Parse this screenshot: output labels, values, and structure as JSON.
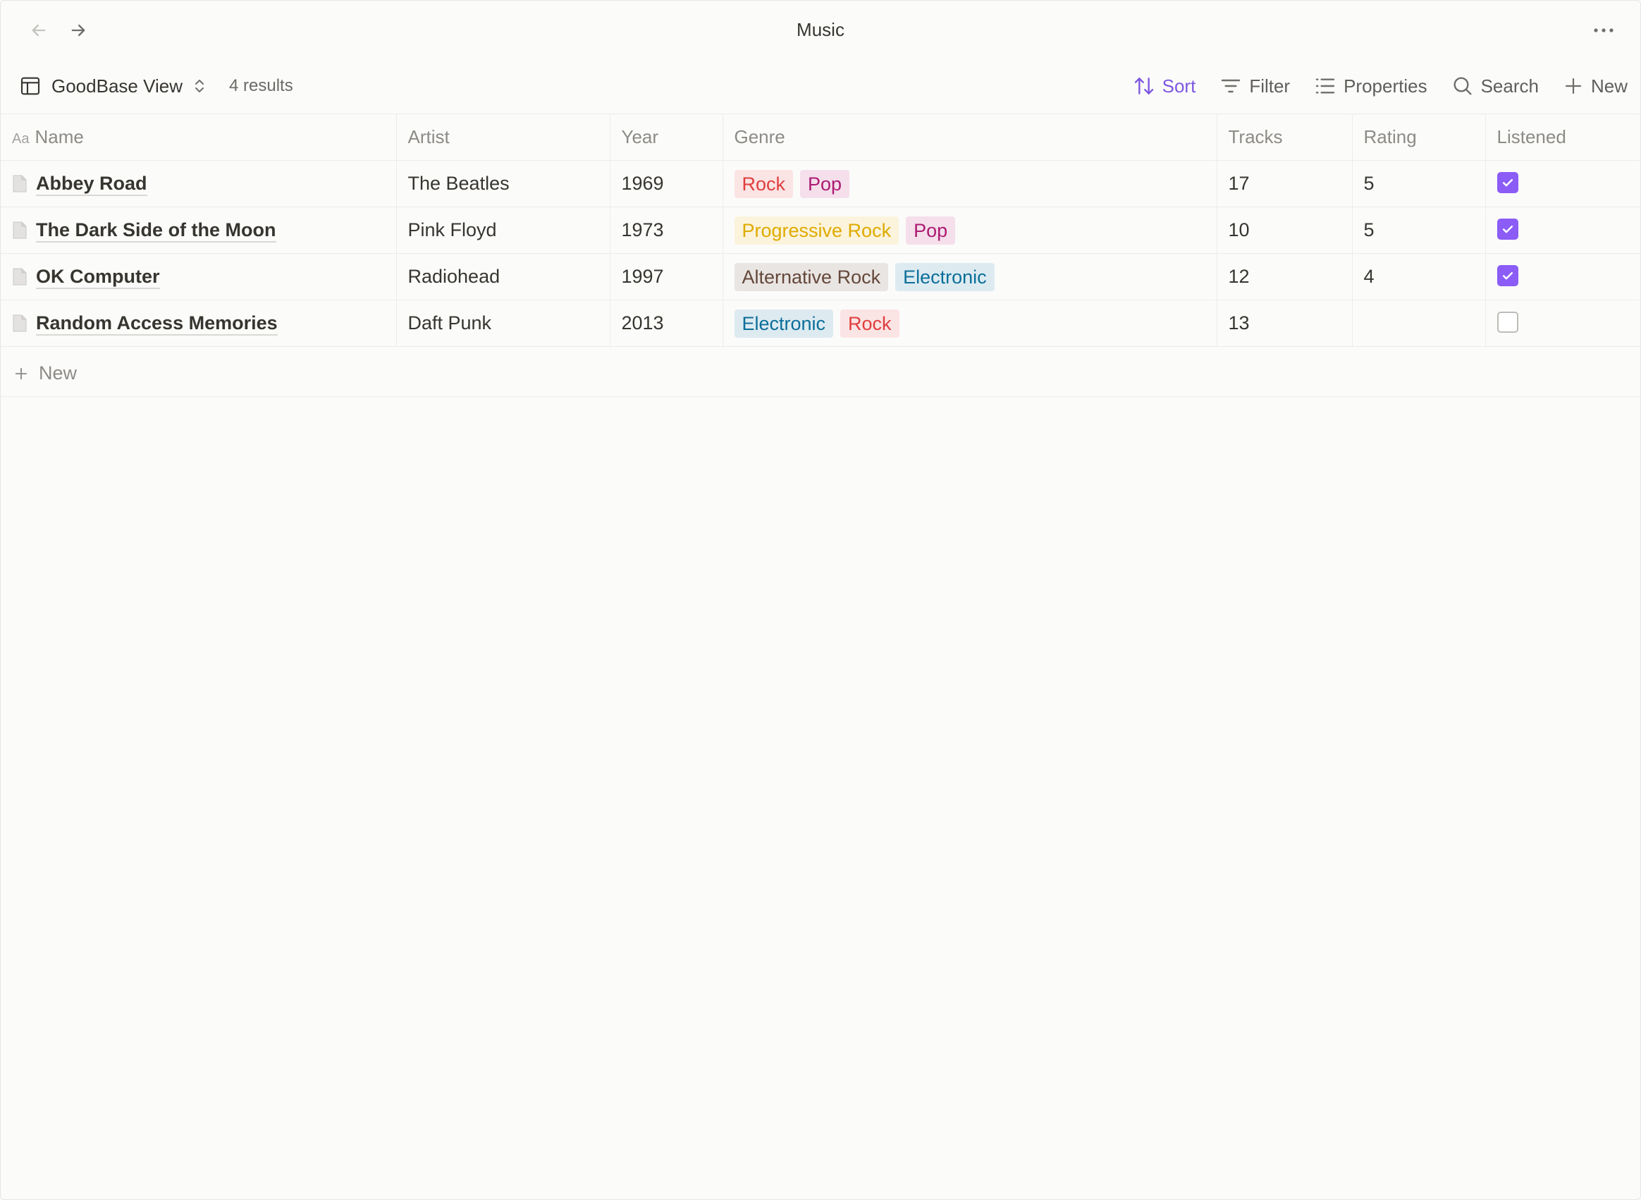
{
  "window": {
    "title": "Music"
  },
  "toolbar": {
    "view_name": "GoodBase View",
    "results": "4 results",
    "sort_label": "Sort",
    "filter_label": "Filter",
    "properties_label": "Properties",
    "search_label": "Search",
    "new_label": "New"
  },
  "table": {
    "columns": {
      "name": "Name",
      "name_prefix": "Aa",
      "artist": "Artist",
      "year": "Year",
      "genre": "Genre",
      "tracks": "Tracks",
      "rating": "Rating",
      "listened": "Listened"
    },
    "rows": [
      {
        "name": "Abbey Road",
        "artist": "The Beatles",
        "year": "1969",
        "genres": [
          {
            "label": "Rock",
            "color": "#e03e3e",
            "bg": "#fbe4e4"
          },
          {
            "label": "Pop",
            "color": "#ad1a72",
            "bg": "#f4dfeb"
          }
        ],
        "tracks": "17",
        "rating": "5",
        "listened": true
      },
      {
        "name": "The Dark Side of the Moon",
        "artist": "Pink Floyd",
        "year": "1973",
        "genres": [
          {
            "label": "Progressive Rock",
            "color": "#dfab01",
            "bg": "#fbf3db"
          },
          {
            "label": "Pop",
            "color": "#ad1a72",
            "bg": "#f4dfeb"
          }
        ],
        "tracks": "10",
        "rating": "5",
        "listened": true
      },
      {
        "name": "OK Computer",
        "artist": "Radiohead",
        "year": "1997",
        "genres": [
          {
            "label": "Alternative Rock",
            "color": "#64473a",
            "bg": "#e9e5e3"
          },
          {
            "label": "Electronic",
            "color": "#0b6e99",
            "bg": "#ddebf1"
          }
        ],
        "tracks": "12",
        "rating": "4",
        "listened": true
      },
      {
        "name": "Random Access Memories",
        "artist": "Daft Punk",
        "year": "2013",
        "genres": [
          {
            "label": "Electronic",
            "color": "#0b6e99",
            "bg": "#ddebf1"
          },
          {
            "label": "Rock",
            "color": "#e03e3e",
            "bg": "#fbe4e4"
          }
        ],
        "tracks": "13",
        "rating": "",
        "listened": false
      }
    ],
    "new_row_label": "New"
  },
  "colors": {
    "accent": "#7e57e0",
    "checkbox_on": "#8b5cf6"
  },
  "icons": {
    "back": "arrow-left-icon",
    "forward": "arrow-right-icon",
    "more": "ellipsis-icon",
    "view": "table-icon",
    "view_switch": "chevron-up-down-icon",
    "sort": "sort-arrows-icon",
    "filter": "filter-icon",
    "properties": "list-icon",
    "search": "search-icon",
    "new": "plus-icon",
    "page": "page-icon",
    "check": "check-icon"
  }
}
